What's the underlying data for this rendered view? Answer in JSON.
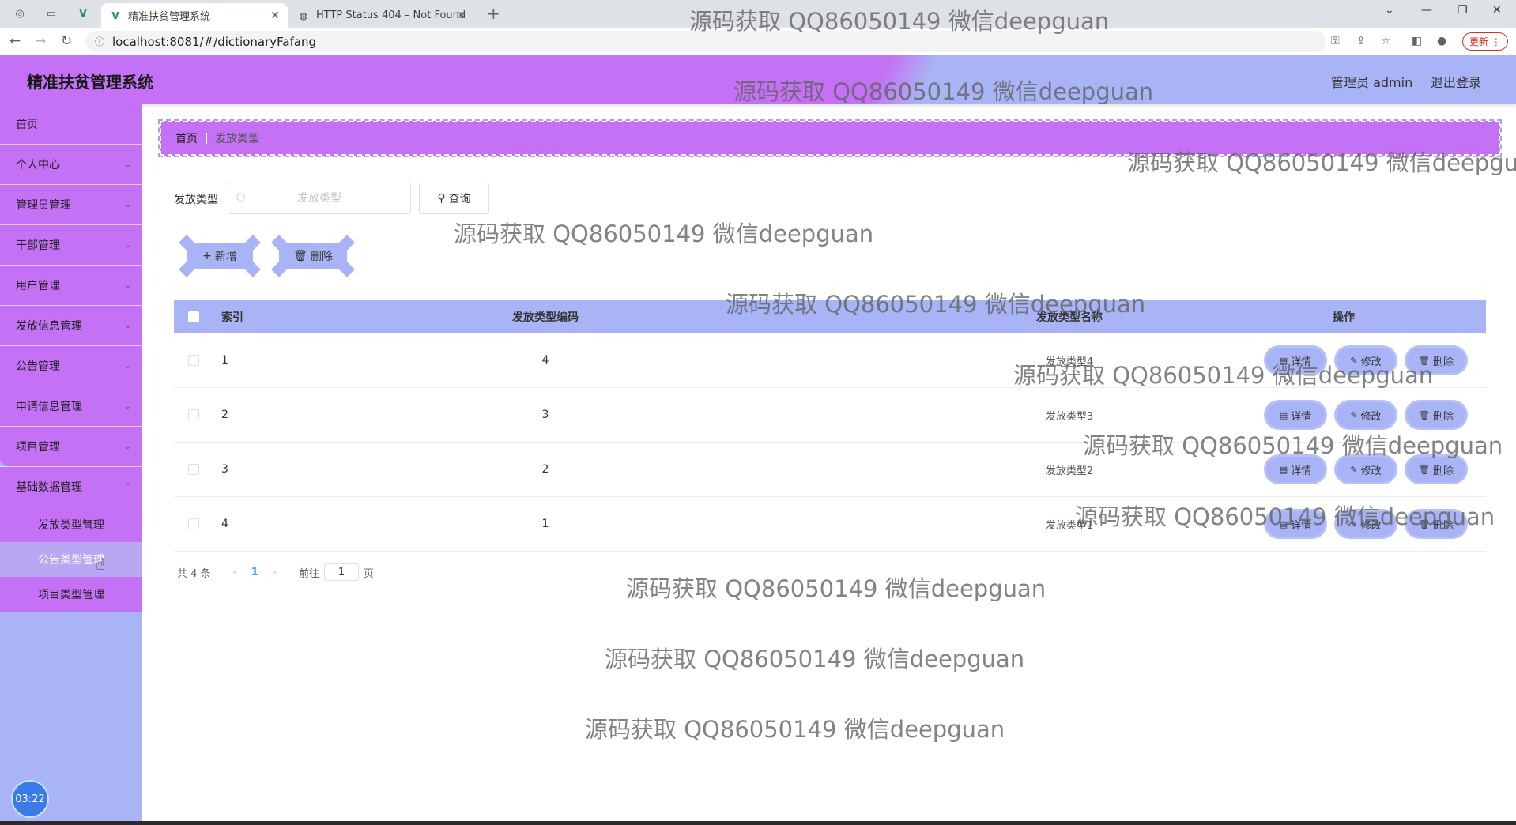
{
  "browser": {
    "tabs": [
      {
        "title": "精准扶贫管理系统",
        "active": true
      },
      {
        "title": "HTTP Status 404 – Not Found",
        "active": false
      }
    ],
    "url": "localhost:8081/#/dictionaryFafang",
    "update_label": "更新"
  },
  "header": {
    "title": "精准扶贫管理系统",
    "user": "管理员 admin",
    "logout": "退出登录"
  },
  "sidebar": {
    "items": [
      {
        "label": "首页",
        "has_children": false
      },
      {
        "label": "个人中心",
        "has_children": true
      },
      {
        "label": "管理员管理",
        "has_children": true
      },
      {
        "label": "干部管理",
        "has_children": true
      },
      {
        "label": "用户管理",
        "has_children": true
      },
      {
        "label": "发放信息管理",
        "has_children": true
      },
      {
        "label": "公告管理",
        "has_children": true
      },
      {
        "label": "申请信息管理",
        "has_children": true
      },
      {
        "label": "项目管理",
        "has_children": true
      },
      {
        "label": "基础数据管理",
        "has_children": true,
        "expanded": true
      }
    ],
    "submenu": [
      {
        "label": "发放类型管理"
      },
      {
        "label": "公告类型管理"
      },
      {
        "label": "项目类型管理"
      }
    ],
    "clock": "03:22"
  },
  "breadcrumb": {
    "home": "首页",
    "current": "发放类型"
  },
  "search": {
    "label": "发放类型",
    "placeholder": "发放类型",
    "value": "",
    "query_button": "查询"
  },
  "actions": {
    "add": "新增",
    "delete": "删除"
  },
  "table": {
    "columns": [
      "索引",
      "发放类型编码",
      "发放类型名称",
      "操作"
    ],
    "rows": [
      {
        "index": "1",
        "code": "4",
        "name": "发放类型4"
      },
      {
        "index": "2",
        "code": "3",
        "name": "发放类型3"
      },
      {
        "index": "3",
        "code": "2",
        "name": "发放类型2"
      },
      {
        "index": "4",
        "code": "1",
        "name": "发放类型1"
      }
    ],
    "row_actions": {
      "detail": "详情",
      "edit": "修改",
      "delete": "删除"
    }
  },
  "pagination": {
    "total": "共 4 条",
    "current_page": "1",
    "goto_prefix": "前往",
    "goto_value": "1",
    "goto_suffix": "页"
  },
  "watermark": "源码获取 QQ86050149 微信deepguan",
  "colors": {
    "purple": "#c471f5",
    "lavender": "#a8b4f5"
  }
}
